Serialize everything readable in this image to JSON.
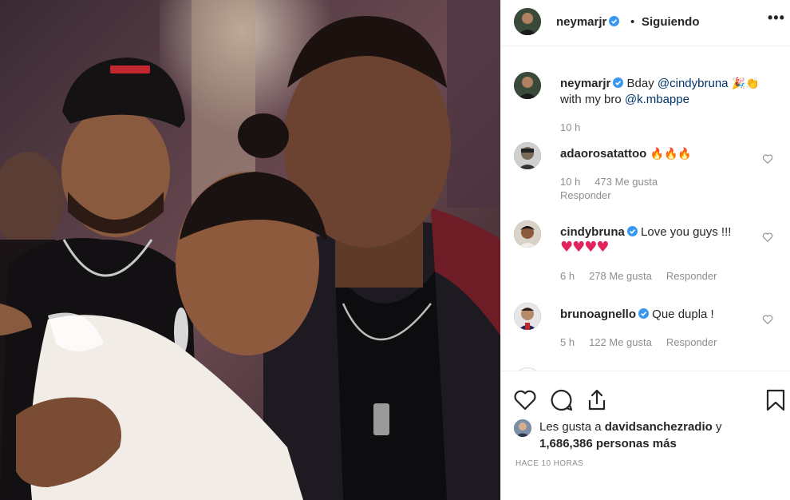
{
  "post": {
    "author": "neymarjr",
    "follow_label": "Siguiendo",
    "separator": "•",
    "more_icon": "more-options-icon",
    "more_label": "•••"
  },
  "caption": {
    "username": "neymarjr",
    "text_before": "Bday ",
    "mention_1": "@cindybruna",
    "emoji": "🎉👏",
    "text_mid": "with my bro ",
    "mention_2": "@k.mbappe",
    "time": "10 h"
  },
  "comments": [
    {
      "username": "adaorosatattoo",
      "text": "🔥🔥🔥",
      "time": "10 h",
      "likes": "473 Me gusta",
      "reply": "Responder"
    },
    {
      "username": "cindybruna",
      "text": "Love you guys !!!",
      "text2": "♥♥♥♥",
      "time": "6 h",
      "likes": "278 Me gusta",
      "reply": "Responder"
    },
    {
      "username": "brunoagnello",
      "text": "Que dupla !",
      "time": "5 h",
      "likes": "122 Me gusta",
      "reply": "Responder"
    }
  ],
  "likes": {
    "prefix": "Les gusta a ",
    "first_user": "davidsanchezradio",
    "suffix": " y",
    "count": "1,686,386 personas más"
  },
  "time_ago": "HACE 10 HORAS",
  "colors": {
    "verified": "#3897f0",
    "heart": "#e0245e",
    "fire": "#f08a1a",
    "mention": "#003569"
  }
}
